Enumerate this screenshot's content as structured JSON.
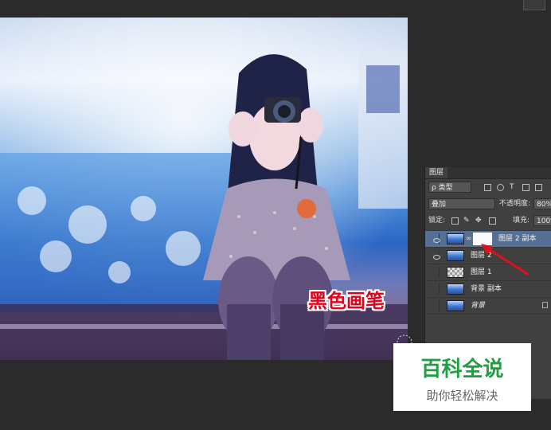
{
  "layers_panel": {
    "tab_label": "图层",
    "filter_kind": "ρ 类型",
    "blend_mode": "叠加",
    "opacity_label": "不透明度:",
    "opacity_value": "80%",
    "lock_label": "锁定:",
    "fill_label": "填充:",
    "fill_value": "100%",
    "layers": [
      {
        "name": "图层 2 副本",
        "visible": true,
        "selected": true,
        "has_mask": true
      },
      {
        "name": "图层 2",
        "visible": true,
        "selected": false
      },
      {
        "name": "图层 1",
        "visible": false,
        "selected": false
      },
      {
        "name": "背景 副本",
        "visible": false,
        "selected": false
      },
      {
        "name": "背景",
        "visible": false,
        "selected": false,
        "locked": true
      }
    ]
  },
  "overlay_caption": "黑色画笔",
  "watermark": {
    "title": "百科全说",
    "subtitle": "助你轻松解决"
  },
  "colors": {
    "app_background": "#2b2b2b",
    "panel_background": "#404040",
    "selected_layer": "#566f94",
    "caption_red": "#e8001a",
    "watermark_green": "#1fa040",
    "arrow_red": "#e0101a"
  }
}
